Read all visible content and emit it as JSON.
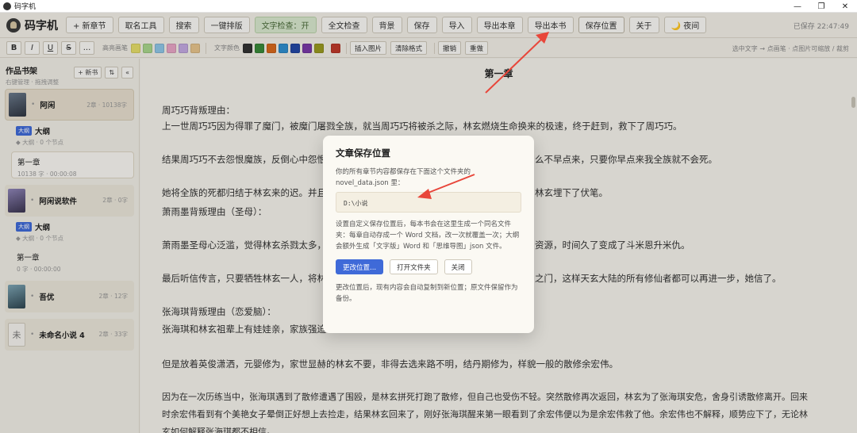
{
  "window": {
    "title": "码字机",
    "controls": [
      "—",
      "❐",
      "✕"
    ]
  },
  "toolbar": {
    "brand": "码字机",
    "buttons": [
      "+ 新章节",
      "取名工具",
      "搜索",
      "一键排版",
      "文字检查：开",
      "全文检查",
      "背景",
      "保存",
      "导入",
      "导出本章",
      "导出本书",
      "保存位置",
      "关于",
      "🌙 夜间"
    ],
    "saved_status": "已保存 22:47:49"
  },
  "format": {
    "buttons": [
      "B",
      "I",
      "U",
      "S",
      "..."
    ],
    "highlight_label": "高亮画笔",
    "highlight_colors": [
      "#e6df6a",
      "#a9d68c",
      "#8fc6e8",
      "#e9a6c6",
      "#c3a9e2",
      "#e8c48c"
    ],
    "text_color_label": "文字颜色",
    "text_colors": [
      "#333333",
      "#3a8a3a",
      "#d9681c",
      "#2f8fd0",
      "#2448a6",
      "#7a3aa8",
      "#9a9a20",
      "#c0392b"
    ],
    "insert_image": "插入图片",
    "clear_format": "清除格式",
    "undo": "撤销",
    "redo": "重做",
    "hint": "选中文字 → 点画笔 · 点图片可缩放 / 裁剪"
  },
  "sidebar": {
    "title": "作品书架",
    "subtitle": "右键管理 · 拖拽调整",
    "new_book": "+ 新书",
    "sort_icon": "⇅",
    "collapse_icon": "«",
    "books": [
      {
        "name": "阿闲",
        "meta": "2章 · 10138字",
        "outline_badge": "大纲",
        "outline_title": "大纲",
        "outline_sub": "◆ 大纲 · 0 个节点",
        "chapter_title": "第一章",
        "chapter_sub": "10138 字 · 00:00:08"
      },
      {
        "name": "阿闲说软件",
        "meta": "2章 · 0字",
        "outline_badge": "大纲",
        "outline_title": "大纲",
        "outline_sub": "◆ 大纲 · 0 个节点",
        "chapter_title": "第一章",
        "chapter_sub": "0 字 · 00:00:00"
      },
      {
        "name": "吾优",
        "meta": "2章 · 12字"
      },
      {
        "name": "未命名小说 4",
        "meta": "2章 · 33字",
        "cover_char": "未"
      }
    ]
  },
  "editor": {
    "chapter_title": "第一章",
    "paragraphs": [
      "周巧巧背叛理由：",
      "上一世周巧巧因为得罪了魔门，被魔门屠戮全族，就当周巧巧将被杀之际，林玄燃烧生命换来的极速，终于赶到，救下了周巧巧。",
      "结果周巧巧不去怨恨魔族，反倒心中怨恨",
      "么不早点来，只要你早点来我全族就不会死。",
      "她将全族的死都归结于林玄来的迟。并且",
      "林玄埋下了伏笔。",
      "萧雨墨背叛理由（圣母）：",
      "萧雨墨圣母心泛滥，觉得林玄杀戮太多，",
      "资源，时间久了变成了斗米恩升米仇。",
      "最后听信传言，只要牺牲林玄一人，将林",
      "之门，这样天玄大陆的所有修仙者都可以再进一步，她信了。",
      "张海琪背叛理由（恋爱脑）：",
      "张海琪和林玄祖辈上有娃娃亲，家族强迫",
      "但是放着英俊潇洒，元婴修为，家世显赫的林玄不要，非得去选来路不明，结丹期修为，样貌一般的散修余宏伟。",
      "因为在一次历练当中，张海琪遇到了散修遭遇了围殴，是林玄拼死打跑了散修，但自己也受伤不轻。突然散修再次返回，林玄为了张海琪安危，舍身引诱散修离开。回来",
      "时余宏伟看到有个美艳女子晕倒正好想上去捡走，结果林玄回来了，刚好张海琪醒来第一眼看到了余宏伟便以为是余宏伟救了他。余宏伟也不解释，顺势应下了，无论林",
      "玄如何解释张海琪都不相信。"
    ]
  },
  "dialog": {
    "title": "文章保存位置",
    "desc": "你的所有章节内容都保存在下面这个文件夹的 novel_data.json 里：",
    "path": "D:\\小说",
    "note": "设置自定义保存位置后，每本书会在这里生成一个同名文件夹：每章自动存成一个 Word 文档，改一次就覆盖一次；大纲会额外生成「文字版」Word 和「思维导图」json 文件。",
    "btn_change": "更改位置...",
    "btn_open": "打开文件夹",
    "btn_close": "关闭",
    "footer": "更改位置后，现有内容会自动复制到新位置；原文件保留作为备份。"
  },
  "colors": {
    "accent": "#3f6ad8",
    "annotation": "#e8463a"
  }
}
